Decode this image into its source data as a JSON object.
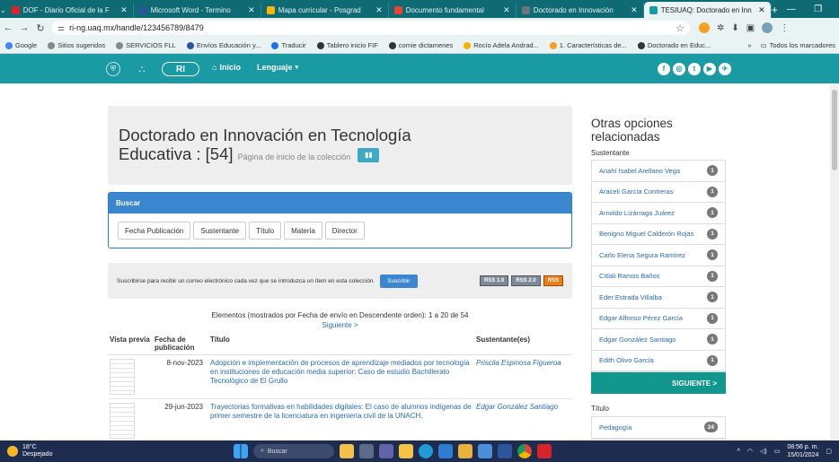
{
  "browser": {
    "tabs": [
      {
        "title": "DOF - Diario Oficial de la F",
        "color": "#d9232a",
        "active": false
      },
      {
        "title": "Microsoft Word - Termino",
        "color": "#2b579a",
        "active": false
      },
      {
        "title": "Mapa curricular - Posgrad",
        "color": "#ffb300",
        "active": false
      },
      {
        "title": "Documento fundamental",
        "color": "#ea4335",
        "active": false
      },
      {
        "title": "Doctorado en Innovación",
        "color": "#6c757d",
        "active": false
      },
      {
        "title": "TESIUAQ: Doctorado en Inn",
        "color": "#1a9aa3",
        "active": true
      }
    ],
    "url": "ri-ng.uaq.mx/handle/123456789/8479",
    "bookmarks": [
      "Google",
      "Sitios sugeridos",
      "SERVICIOS FLL",
      "Envíos Educación y...",
      "Traducir",
      "Tablero inicio FIF",
      "comie dictamenes",
      "Rocío Adela Andrad...",
      "1. Características de...",
      "Doctorado en Educ..."
    ],
    "all_bookmarks": "Todos los marcadores",
    "more": "»"
  },
  "sitenav": {
    "logo_text": "RI",
    "home": "Inicio",
    "language": "Lenguaje",
    "social": [
      "f",
      "◎",
      "t",
      "▶",
      "✈"
    ]
  },
  "collection": {
    "title_line1": "Doctorado en Innovación en Tecnología",
    "title_line2": "Educativa : [54]",
    "subtitle": "Página de inicio de la colección"
  },
  "browse": {
    "header": "Buscar",
    "buttons": [
      "Fecha Publicación",
      "Sustentante",
      "Título",
      "Materia",
      "Director"
    ]
  },
  "subscribe": {
    "text": "Suscribirse para recibir un correo electrónico cada vez que se introduzca un ítem en esta colección.",
    "button": "Suscribir",
    "feeds": [
      "RSS 1.0",
      "RSS 2.0",
      "RSS"
    ]
  },
  "listing": {
    "summary": "Elementos (mostrados por Fecha de envío en Descendente orden): 1 a 20 de 54",
    "next": "Siguiente >",
    "columns": [
      "Vista previa",
      "Fecha de publicación",
      "Título",
      "Sustentante(es)"
    ],
    "rows": [
      {
        "date": "8-nov-2023",
        "title": "Adopción e implementación de procesos de aprendizaje mediados por tecnología en instituciones de educación media superior: Caso de estudio Bachillerato Tecnológico de El Grullo",
        "author": "Priscila Espinosa Figueroa"
      },
      {
        "date": "29-jun-2023",
        "title": "Trayectorias formativas en habilidades digitales: El caso de alumnos indígenas de primer semestre de la licenciatura en ingeniería civil de la UNACH.",
        "author": "Edgar González Santiago"
      }
    ]
  },
  "sidebar": {
    "heading": "Otras opciones relacionadas",
    "sustentante_label": "Sustentante",
    "items": [
      {
        "name": "Anahí Isabel Arellano Vega",
        "count": "1"
      },
      {
        "name": "Araceli García Contreras",
        "count": "1"
      },
      {
        "name": "Arnoldo Lizárraga Juárez",
        "count": "1"
      },
      {
        "name": "Benigno Miguel Calderón Rojas",
        "count": "1"
      },
      {
        "name": "Carlo Elena Segura Ramírez",
        "count": "1"
      },
      {
        "name": "Citlali Ramos Baños",
        "count": "1"
      },
      {
        "name": "Eder Estrada Villalba",
        "count": "1"
      },
      {
        "name": "Edgar Alfonso Pérez García",
        "count": "1"
      },
      {
        "name": "Edgar González Santiago",
        "count": "1"
      },
      {
        "name": "Edith Olivo García",
        "count": "1"
      }
    ],
    "next": "SIGUIENTE >",
    "tema_label": "Título",
    "tema_items": [
      {
        "name": "Pedagogía",
        "count": "24"
      }
    ]
  },
  "taskbar": {
    "temp": "18°C",
    "weather": "Despejado",
    "search": "Buscar",
    "time": "08:56 p. m.",
    "date": "15/01/2024"
  }
}
